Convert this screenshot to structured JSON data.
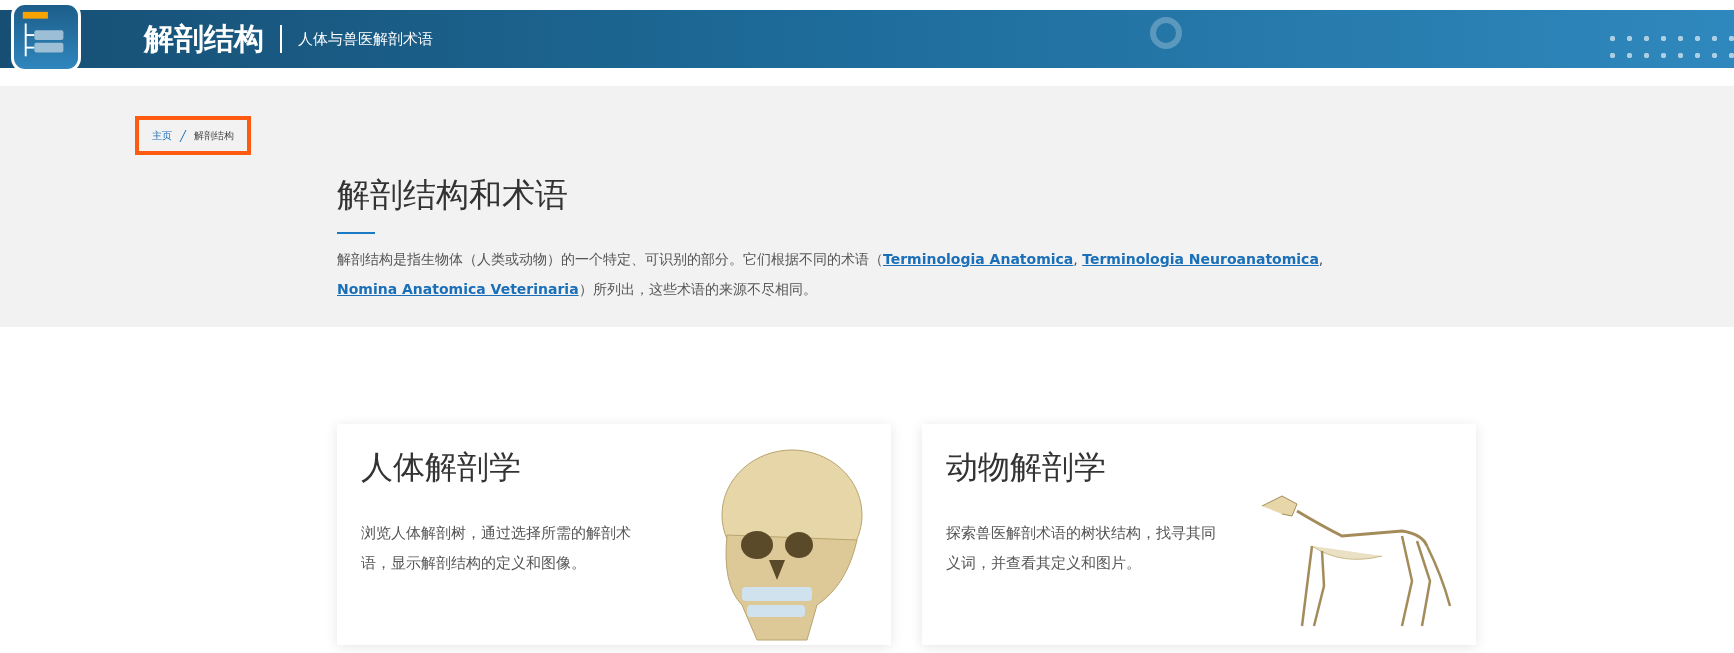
{
  "header": {
    "title": "解剖结构",
    "subtitle": "人体与兽医解剖术语"
  },
  "breadcrumb": [
    {
      "label": "主页",
      "kind": "link"
    },
    {
      "label": "解剖结构",
      "kind": "current"
    }
  ],
  "heading": "解剖结构和术语",
  "intro": [
    {
      "kind": "text",
      "text": "解剖结构是指生物体（人类或动物）的一个特定、可识别的部分。它们根据不同的术语（"
    },
    {
      "kind": "link",
      "text": "Terminologia Anatomica"
    },
    {
      "kind": "text",
      "text": ", "
    },
    {
      "kind": "link",
      "text": "Terminologia Neuroanatomica"
    },
    {
      "kind": "text",
      "text": ", "
    },
    {
      "kind": "link",
      "text": "Nomina Anatomica Veterinaria"
    },
    {
      "kind": "text",
      "text": "）所列出，这些术语的来源不尽相同。"
    }
  ],
  "cards": [
    {
      "title": "人体解剖学",
      "description": "浏览人体解剖树，通过选择所需的解剖术语，显示解剖结构的定义和图像。",
      "kind": "skull"
    },
    {
      "title": "动物解剖学",
      "description": "探索兽医解剖术语的树状结构，找寻其同义词，并查看其定义和图片。",
      "kind": "dog"
    }
  ]
}
